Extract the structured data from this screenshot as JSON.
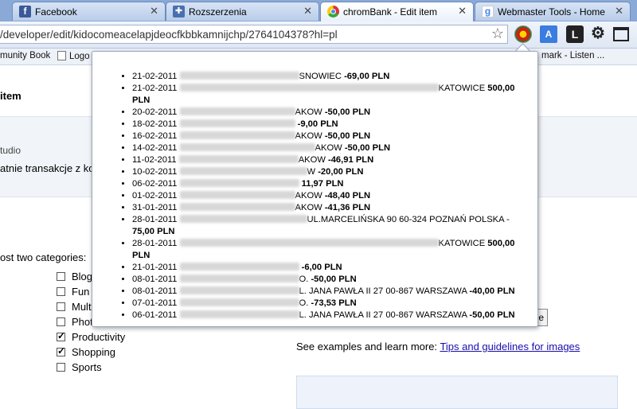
{
  "tabs": [
    {
      "title": "Facebook",
      "icon": "facebook-icon",
      "active": false
    },
    {
      "title": "Rozszerzenia",
      "icon": "puzzle-icon",
      "active": false
    },
    {
      "title": "chromBank - Edit item",
      "icon": "chrome-icon",
      "active": true
    },
    {
      "title": "Webmaster Tools - Home",
      "icon": "google-icon",
      "active": false
    }
  ],
  "toolbar": {
    "url": "/developer/edit/kidocomeacelapjdeocfkbbkamnijchp/2764104378?hl=pl"
  },
  "bookmarks": [
    {
      "label": "munity Book"
    },
    {
      "label": "Logo"
    },
    {
      "label": "mark - Listen ..."
    }
  ],
  "page": {
    "heading": "item",
    "studio": "tudio",
    "description": "atnie transakcje z ko",
    "categories_label": "ost two categories:",
    "categories": [
      {
        "label": "Blog",
        "checked": false
      },
      {
        "label": "Fun",
        "checked": false
      },
      {
        "label": "Mult",
        "checked": false
      },
      {
        "label": "Phot",
        "checked": false
      },
      {
        "label": "Productivity",
        "checked": true
      },
      {
        "label": "Shopping",
        "checked": true
      },
      {
        "label": "Sports",
        "checked": false
      }
    ],
    "examples_text": "See examples and learn more:",
    "examples_link": "Tips and guidelines for images",
    "partial_button": "e"
  },
  "popup": {
    "transactions": [
      {
        "date": "21-02-2011",
        "tail": "SNOWIEC",
        "amount": "-69,00 PLN"
      },
      {
        "date": "21-02-2011",
        "tail": "KATOWICE",
        "amount": "500,00 PLN"
      },
      {
        "date": "20-02-2011",
        "tail": "AKOW",
        "amount": "-50,00 PLN"
      },
      {
        "date": "18-02-2011",
        "tail": "",
        "amount": "-9,00 PLN"
      },
      {
        "date": "16-02-2011",
        "tail": "AKOW",
        "amount": "-50,00 PLN"
      },
      {
        "date": "14-02-2011",
        "tail": "AKOW",
        "amount": "-50,00 PLN"
      },
      {
        "date": "11-02-2011",
        "tail": "AKOW",
        "amount": "-46,91 PLN"
      },
      {
        "date": "10-02-2011",
        "tail": "W",
        "amount": "-20,00 PLN"
      },
      {
        "date": "06-02-2011",
        "tail": "",
        "amount": "11,97 PLN"
      },
      {
        "date": "01-02-2011",
        "tail": "AKOW",
        "amount": "-48,40 PLN"
      },
      {
        "date": "31-01-2011",
        "tail": "AKOW",
        "amount": "-41,36 PLN"
      },
      {
        "date": "28-01-2011",
        "tail": "UL.MARCELIŃSKA 90 60-324 POZNAŃ POLSKA -",
        "amount": "75,00 PLN"
      },
      {
        "date": "28-01-2011",
        "tail": "KATOWICE",
        "amount": "500,00 PLN"
      },
      {
        "date": "21-01-2011",
        "tail": "",
        "amount": "-6,00 PLN"
      },
      {
        "date": "08-01-2011",
        "tail": "O.",
        "amount": "-50,00 PLN"
      },
      {
        "date": "08-01-2011",
        "tail": "L. JANA PAWŁA II 27 00-867 WARSZAWA",
        "amount": "-40,00 PLN"
      },
      {
        "date": "07-01-2011",
        "tail": "O.",
        "amount": "-73,53 PLN"
      },
      {
        "date": "06-01-2011",
        "tail": "L. JANA PAWŁA II 27 00-867 WARSZAWA",
        "amount": "-50,00 PLN"
      }
    ]
  }
}
